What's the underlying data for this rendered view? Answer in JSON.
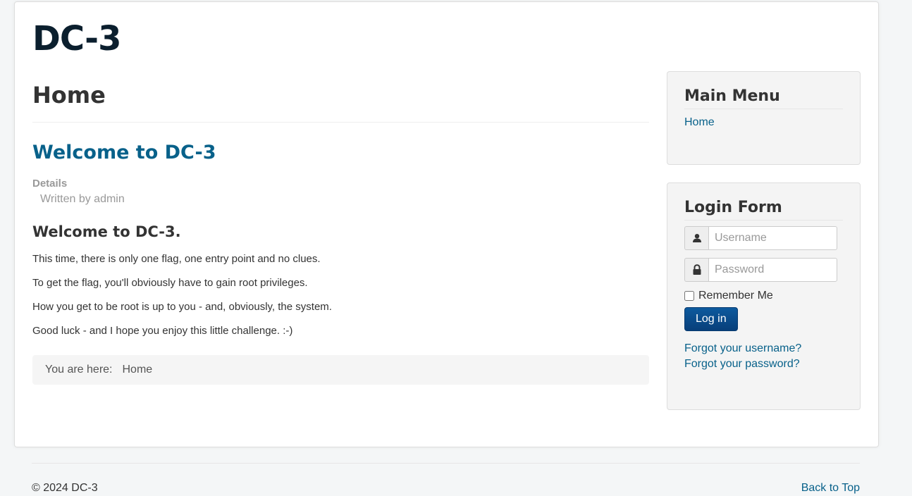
{
  "site": {
    "brand": "DC-3"
  },
  "main": {
    "page_title": "Home",
    "article": {
      "title": "Welcome to DC-3",
      "details_label": "Details",
      "written_by": "Written by admin",
      "heading": "Welcome to DC-3.",
      "paragraphs": [
        "This time, there is only one flag, one entry point and no clues.",
        "To get the flag, you'll obviously have to gain root privileges.",
        "How you get to be root is up to you - and, obviously, the system.",
        "Good luck - and I hope you enjoy this little challenge.  :-)"
      ]
    },
    "breadcrumb": {
      "label": "You are here:",
      "current": "Home"
    }
  },
  "sidebar": {
    "main_menu": {
      "title": "Main Menu",
      "items": [
        {
          "label": "Home"
        }
      ]
    },
    "login_form": {
      "title": "Login Form",
      "username_placeholder": "Username",
      "password_placeholder": "Password",
      "remember_label": "Remember Me",
      "login_button": "Log in",
      "forgot_username": "Forgot your username?",
      "forgot_password": "Forgot your password?"
    }
  },
  "footer": {
    "copyright": "© 2024 DC-3",
    "back_to_top": "Back to Top"
  },
  "colors": {
    "link": "#08618a",
    "brand": "#0b1f2e",
    "button": "#0d5a9e",
    "background": "#f4f6f7"
  },
  "icons": {
    "user": "user-icon",
    "lock": "lock-icon"
  }
}
